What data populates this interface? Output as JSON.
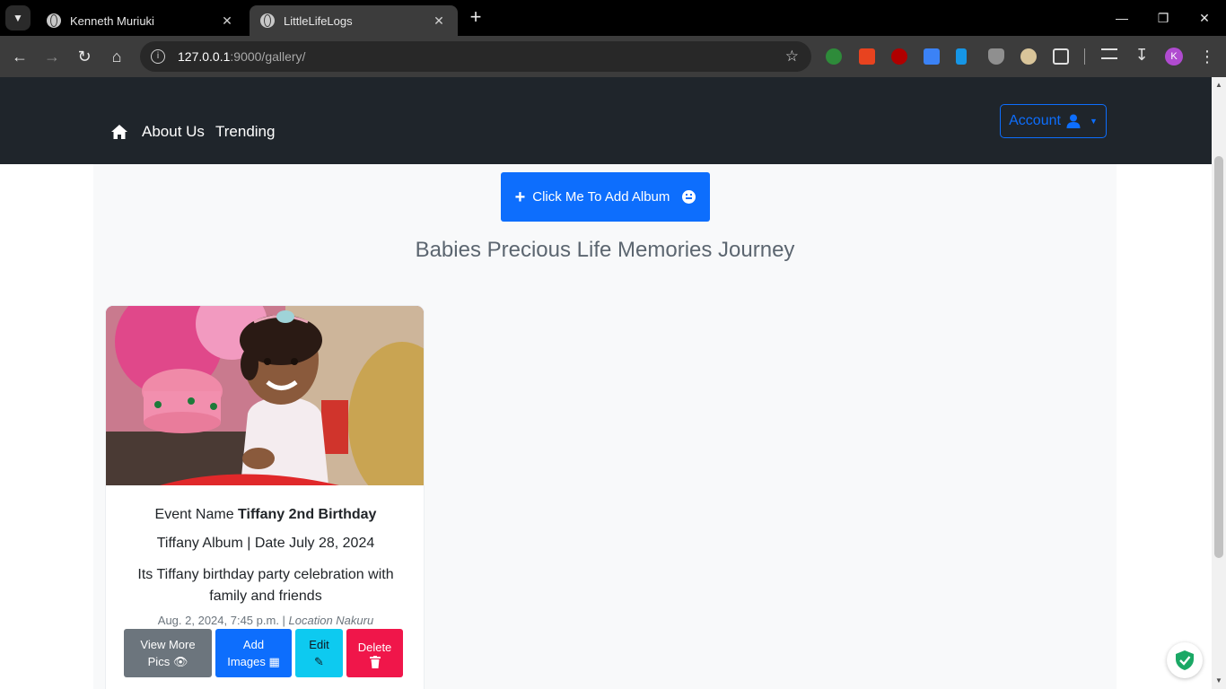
{
  "browser": {
    "tabs": [
      {
        "title": "Kenneth Muriuki",
        "active": false
      },
      {
        "title": "LittleLifeLogs",
        "active": true
      }
    ],
    "url": {
      "host": "127.0.0.1",
      "path": ":9000/gallery/"
    },
    "profile_initial": "K",
    "icons": {
      "tab_search": "chevron-down-icon",
      "new_tab": "plus-icon",
      "back": "arrow-left-icon",
      "forward": "arrow-right-icon",
      "reload": "reload-icon",
      "home": "home-icon",
      "site_info": "info-icon",
      "bookmark": "star-icon",
      "downloads": "download-icon",
      "menu": "kebab-icon"
    }
  },
  "site": {
    "nav": {
      "home_icon": "home-icon",
      "links": [
        "About Us",
        "Trending"
      ],
      "account_label": "Account"
    },
    "add_album_label": "Click Me To Add Album",
    "heading": "Babies Precious Life Memories Journey",
    "albums": [
      {
        "event_prefix": "Event Name",
        "event_name": "Tiffany 2nd Birthday",
        "album_line": "Tiffany Album | Date July 28, 2024",
        "description": "Its Tiffany birthday party celebration with family and friends",
        "posted": "Aug. 2, 2024, 7:45 p.m. | ",
        "location": "Location Nakuru",
        "buttons": {
          "view_line1": "View More",
          "view_line2": "Pics",
          "add_line1": "Add",
          "add_line2": "Images",
          "edit": "Edit",
          "delete": "Delete"
        }
      }
    ]
  },
  "colors": {
    "navbar": "#1f252b",
    "primary": "#0d6efd",
    "secondary": "#6c757d",
    "info": "#0dcaf0",
    "danger": "#f0164a"
  }
}
